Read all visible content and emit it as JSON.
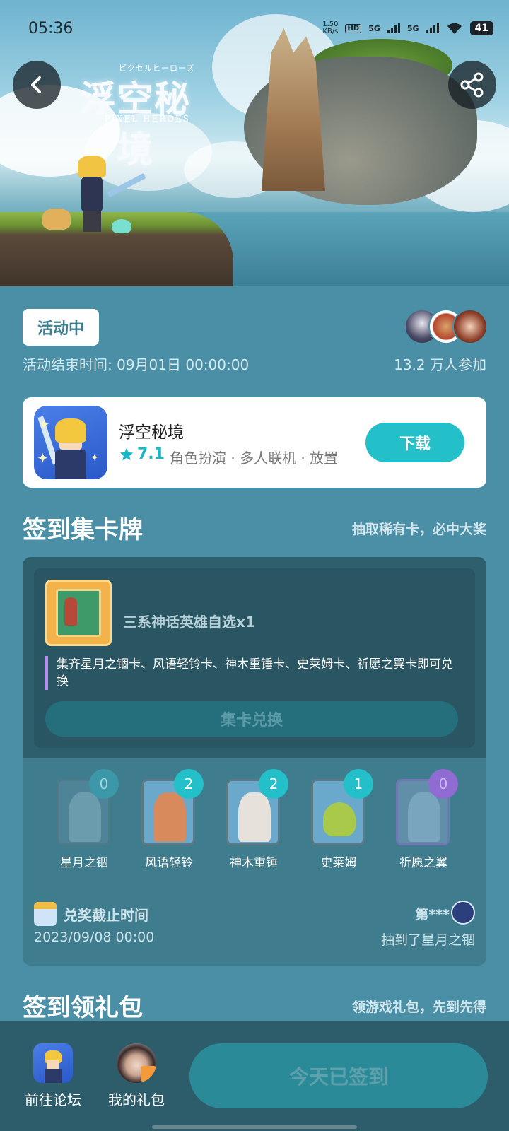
{
  "status_bar": {
    "time": "05:36",
    "speed_value": "1.50",
    "speed_unit": "KB/s",
    "hd_badge": "HD",
    "network_1": "5G",
    "network_2": "5G",
    "battery": "41"
  },
  "hero": {
    "logo_kana": "ピクセルヒーローズ",
    "logo_title": "浮空秘境",
    "logo_subtitle": "PIXEL HEROES"
  },
  "activity": {
    "status_badge": "活动中",
    "end_time": "活动结束时间: 09月01日 00:00:00",
    "participants": "13.2 万人参加"
  },
  "game": {
    "name": "浮空秘境",
    "rating": "7.1",
    "tags": "角色扮演 · 多人联机 · 放置",
    "download_label": "下载"
  },
  "card_section": {
    "title": "签到集卡牌",
    "subtitle": "抽取稀有卡，必中大奖",
    "reward_title": "三系神话英雄自选x1",
    "reward_desc": "集齐星月之锢卡、风语轻铃卡、神木重锤卡、史莱姆卡、祈愿之翼卡即可兑换",
    "exchange_label": "集卡兑换",
    "cards": [
      {
        "name": "星月之锢",
        "count": "0",
        "color": "#8fb7c9"
      },
      {
        "name": "风语轻铃",
        "count": "2",
        "color": "#d98a5c"
      },
      {
        "name": "神木重锤",
        "count": "2",
        "color": "#e6e1da"
      },
      {
        "name": "史莱姆",
        "count": "1",
        "color": "#a8c94a"
      },
      {
        "name": "祈愿之翼",
        "count": "0",
        "color": "#a9c8e6"
      }
    ],
    "deadline_label": "兑奖截止时间",
    "deadline_value": "2023/09/08 00:00",
    "winner_name": "第***",
    "winner_desc": "抽到了星月之锢"
  },
  "gift_section": {
    "title": "签到领礼包",
    "subtitle": "领游戏礼包，先到先得"
  },
  "bottom_bar": {
    "forum_label": "前往论坛",
    "gift_label": "我的礼包",
    "signin_label": "今天已签到"
  }
}
